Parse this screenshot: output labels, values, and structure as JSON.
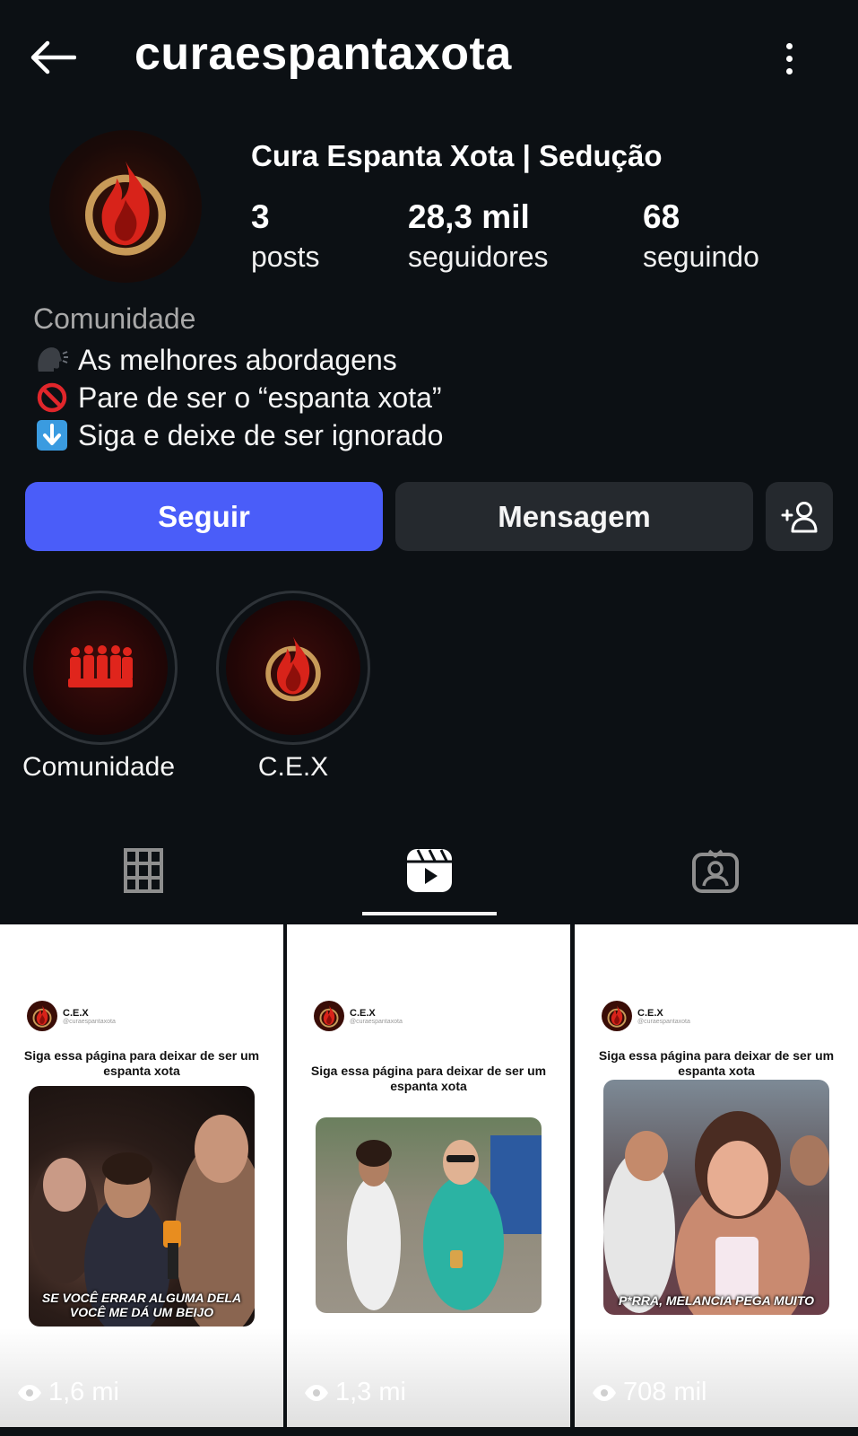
{
  "header": {
    "username": "curaespantaxota"
  },
  "profile": {
    "display_name": "Cura Espanta Xota | Sedução",
    "stats": [
      {
        "value": "3",
        "label": "posts"
      },
      {
        "value": "28,3 mil",
        "label": "seguidores"
      },
      {
        "value": "68",
        "label": "seguindo"
      }
    ],
    "category": "Comunidade",
    "bio": [
      {
        "icon": "speaking-head-icon",
        "text": "As melhores abordagens"
      },
      {
        "icon": "prohibited-icon",
        "text": "Pare de ser o “espanta xota”"
      },
      {
        "icon": "down-arrow-icon",
        "text": "Siga e deixe de ser ignorado"
      }
    ]
  },
  "actions": {
    "follow": "Seguir",
    "message": "Mensagem",
    "add_person_icon": "add-person-icon"
  },
  "highlights": [
    {
      "label": "Comunidade",
      "icon": "group-icon"
    },
    {
      "label": "C.E.X",
      "icon": "flame-icon"
    }
  ],
  "tabs": [
    {
      "icon": "grid-icon",
      "active": false
    },
    {
      "icon": "reels-icon",
      "active": true
    },
    {
      "icon": "tagged-icon",
      "active": false
    }
  ],
  "reels": [
    {
      "account": "C.E.X",
      "handle": "@curaespantaxota",
      "caption": "Siga essa página para deixar de ser um espanta xota",
      "overlay": "SE VOCÊ ERRAR ALGUMA DELA VOCÊ ME DÁ UM BEIJO",
      "views": "1,6 mi"
    },
    {
      "account": "C.E.X",
      "handle": "@curaespantaxota",
      "caption": "Siga essa página para deixar de ser um espanta xota",
      "overlay": "",
      "views": "1,3 mi"
    },
    {
      "account": "C.E.X",
      "handle": "@curaespantaxota",
      "caption": "Siga essa página para deixar de ser um espanta xota",
      "overlay": "P*RRA, MELANCIA PEGA MUITO",
      "views": "708 mil"
    }
  ],
  "colors": {
    "background": "#0c1014",
    "follow_button": "#4a5df9",
    "secondary_button": "#25292e",
    "brand_red": "#c8201a",
    "brand_gold": "#c89a58"
  }
}
